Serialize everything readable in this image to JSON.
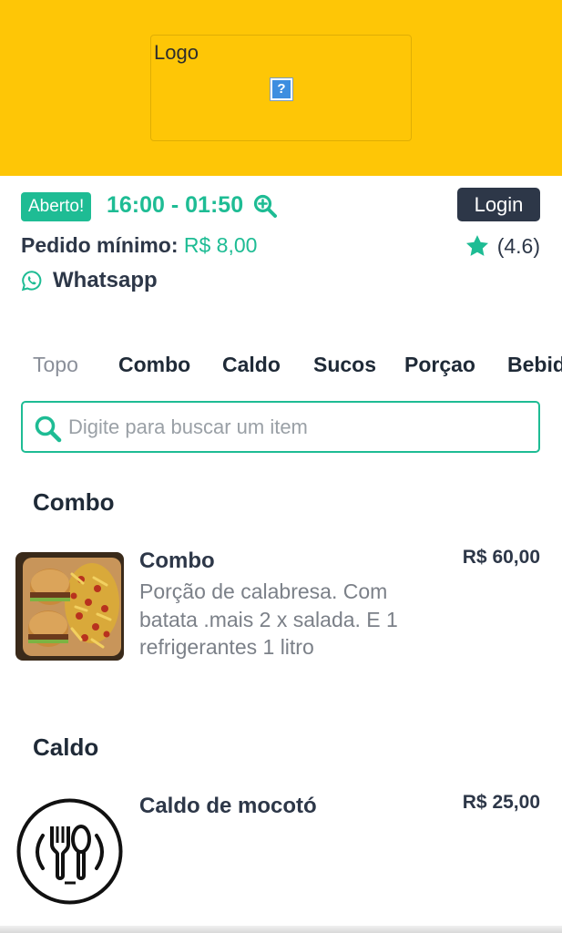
{
  "header": {
    "logo_label": "Logo",
    "logo_broken_glyph": "?"
  },
  "status": {
    "open_badge": "Aberto!",
    "hours": "16:00 - 01:50",
    "login_label": "Login",
    "min_order_label": "Pedido mínimo:",
    "min_order_value": "R$ 8,00",
    "rating": "(4.6)",
    "whatsapp_label": "Whatsapp"
  },
  "tabs": [
    "Topo",
    "Combo",
    "Caldo",
    "Sucos",
    "Porçao",
    "Bebidas"
  ],
  "search": {
    "placeholder": "Digite para buscar um item"
  },
  "sections": [
    {
      "title": "Combo",
      "items": [
        {
          "name": "Combo",
          "description": "Porção de calabresa. Com batata .mais 2 x salada. E 1 refrigerantes 1 litro",
          "price": "R$ 60,00",
          "image": "food-photo"
        }
      ]
    },
    {
      "title": "Caldo",
      "items": [
        {
          "name": "Caldo de mocotó",
          "description": "",
          "price": "R$ 25,00",
          "image": "fork-spoon-icon"
        }
      ]
    }
  ],
  "colors": {
    "brand_yellow": "#fec606",
    "accent_green": "#1ebc94",
    "dark": "#2d3748"
  }
}
